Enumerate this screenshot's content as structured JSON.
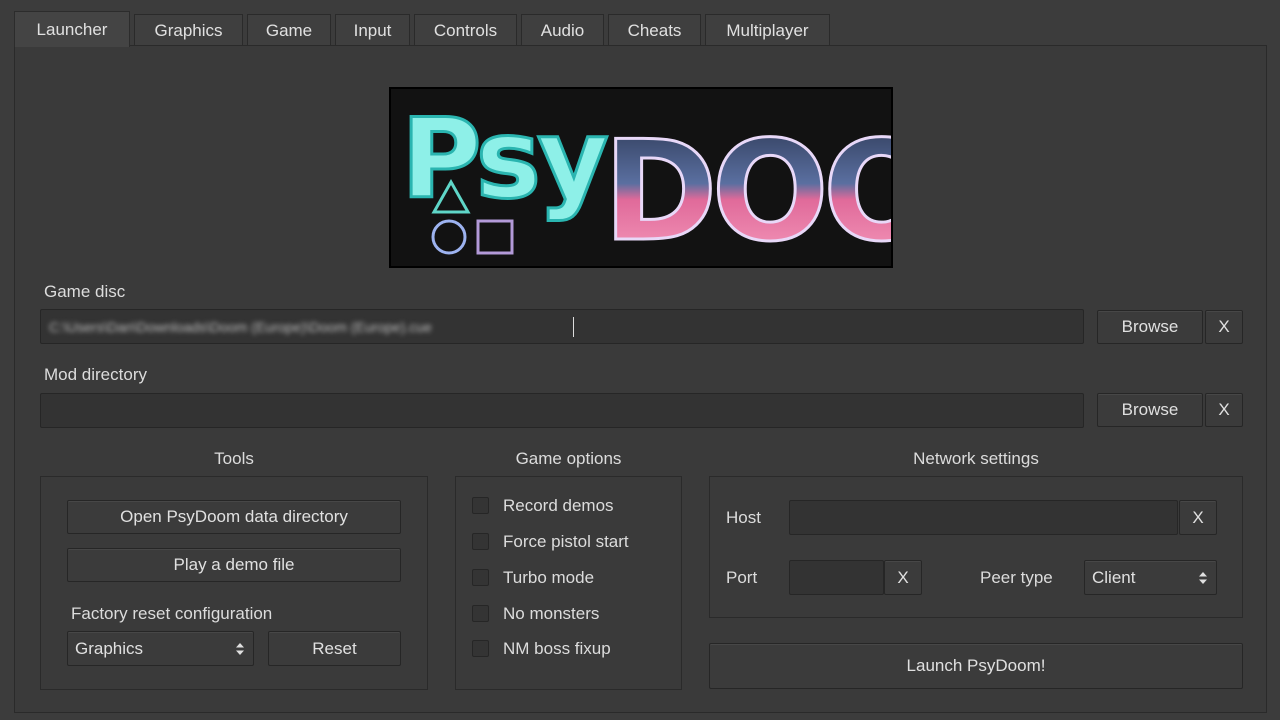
{
  "tabs": [
    "Launcher",
    "Graphics",
    "Game",
    "Input",
    "Controls",
    "Audio",
    "Cheats",
    "Multiplayer"
  ],
  "active_tab": "Launcher",
  "logo": {
    "text_left": "Psy",
    "text_right": "DOOM"
  },
  "game_disc": {
    "label": "Game disc",
    "value": "C:\\Users\\Dan\\Downloads\\Doom (Europe)\\Doom (Europe).cue",
    "browse_label": "Browse",
    "clear_label": "X"
  },
  "mod_directory": {
    "label": "Mod directory",
    "value": "",
    "browse_label": "Browse",
    "clear_label": "X"
  },
  "tools": {
    "title": "Tools",
    "open_data_dir_label": "Open PsyDoom data directory",
    "play_demo_label": "Play a demo file",
    "factory_reset_label": "Factory reset configuration",
    "reset_select_value": "Graphics",
    "reset_button_label": "Reset"
  },
  "game_options": {
    "title": "Game options",
    "items": [
      {
        "label": "Record demos",
        "checked": false
      },
      {
        "label": "Force pistol start",
        "checked": false
      },
      {
        "label": "Turbo mode",
        "checked": false
      },
      {
        "label": "No monsters",
        "checked": false
      },
      {
        "label": "NM boss fixup",
        "checked": false
      }
    ]
  },
  "network": {
    "title": "Network settings",
    "host_label": "Host",
    "host_value": "",
    "host_clear_label": "X",
    "port_label": "Port",
    "port_value": "",
    "port_clear_label": "X",
    "peer_type_label": "Peer type",
    "peer_type_value": "Client"
  },
  "launch_label": "Launch PsyDoom!"
}
